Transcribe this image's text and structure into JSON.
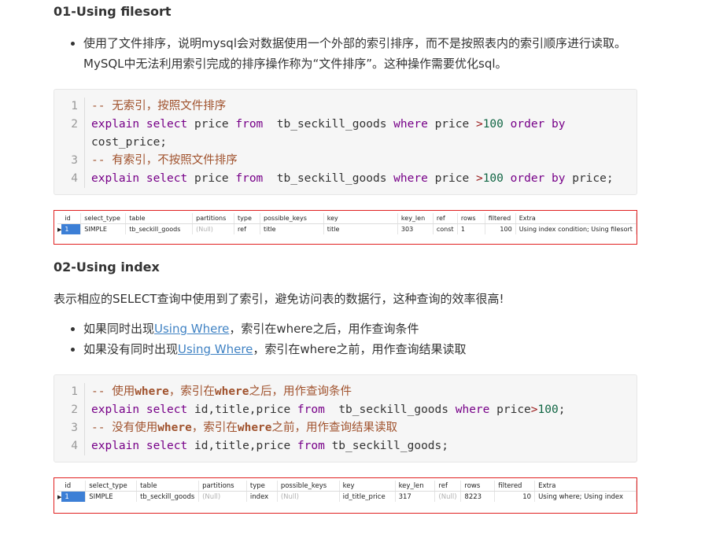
{
  "section1": {
    "heading": "01-Using filesort",
    "bullet": "使用了文件排序，说明mysql会对数据使用一个外部的索引排序，而不是按照表内的索引顺序进行读取。MySQL中无法利用索引完成的排序操作称为“文件排序”。这种操作需要优化sql。",
    "code": {
      "line_numbers": [
        "1",
        "2",
        "3",
        "4"
      ],
      "comment1": "-- 无索引，按照文件排序",
      "comment2": "-- 有索引，不按照文件排序",
      "kw_explain": "explain",
      "kw_select": "select",
      "kw_from": "from",
      "kw_where": "where",
      "kw_order": "order",
      "kw_by": "by",
      "col_price": "price",
      "table": "tb_seckill_goods",
      "op_gt": ">",
      "num_100": "100",
      "col_cost_price": "cost_price;",
      "col_price_end": "price;"
    },
    "result": {
      "headers": [
        "id",
        "select_type",
        "table",
        "partitions",
        "type",
        "possible_keys",
        "key",
        "key_len",
        "ref",
        "rows",
        "filtered",
        "Extra"
      ],
      "row": [
        "1",
        "SIMPLE",
        "tb_seckill_goods",
        "(Null)",
        "ref",
        "title",
        "title",
        "303",
        "const",
        "1",
        "100",
        "Using index condition; Using filesort"
      ]
    }
  },
  "section2": {
    "heading": "02-Using index",
    "description": "表示相应的SELECT查询中使用到了索引，避免访问表的数据行，这种查询的效率很高!",
    "bullet1_prefix": "如果同时出现",
    "bullet1_link": "Using Where",
    "bullet1_suffix": "，索引在where之后，用作查询条件",
    "bullet2_prefix": "如果没有同时出现",
    "bullet2_link": "Using Where",
    "bullet2_suffix": "，索引在where之前，用作查询结果读取",
    "code": {
      "line_numbers": [
        "1",
        "2",
        "3",
        "4"
      ],
      "c1a": "-- 使用",
      "c1b": "where",
      "c1c": "，索引在",
      "c1d": "where",
      "c1e": "之后，用作查询条件",
      "c2a": "-- 没有使用",
      "c2b": "where",
      "c2c": "，索引在",
      "c2d": "where",
      "c2e": "之前，用作查询结果读取",
      "kw_explain": "explain",
      "kw_select": "select",
      "kw_from": "from",
      "kw_where": "where",
      "cols": "id,title,price",
      "table": "tb_seckill_goods",
      "table_end": "tb_seckill_goods;",
      "col_price": "price",
      "op_gt": ">",
      "num_100": "100",
      "semicolon": ";"
    },
    "result": {
      "headers": [
        "id",
        "select_type",
        "table",
        "partitions",
        "type",
        "possible_keys",
        "key",
        "key_len",
        "ref",
        "rows",
        "filtered",
        "Extra"
      ],
      "row": [
        "1",
        "SIMPLE",
        "tb_seckill_goods",
        "(Null)",
        "index",
        "(Null)",
        "id_title_price",
        "317",
        "(Null)",
        "8223",
        "10",
        "Using where; Using index"
      ]
    }
  }
}
